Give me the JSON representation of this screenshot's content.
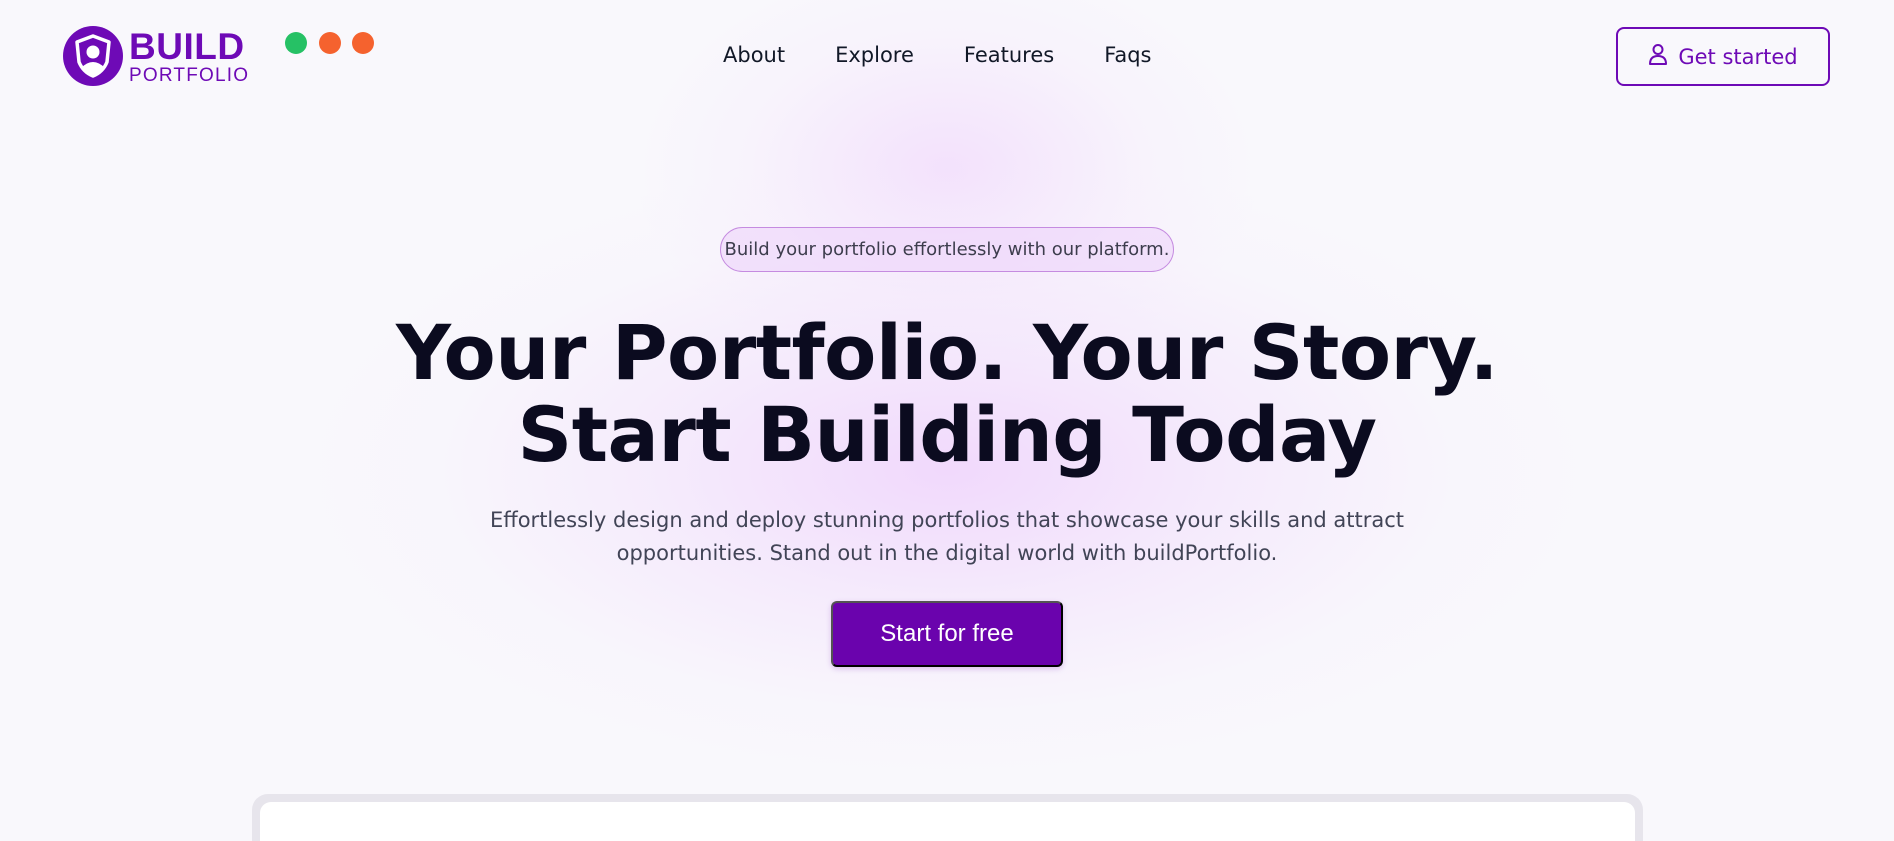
{
  "brand": {
    "name_top": "BUILD",
    "name_bottom": "PORTFOLIO",
    "accent_color": "#6e0ab6",
    "logo_icon": "shield-user-icon"
  },
  "nav": {
    "items": [
      {
        "label": "About"
      },
      {
        "label": "Explore"
      },
      {
        "label": "Features"
      },
      {
        "label": "Faqs"
      }
    ]
  },
  "header_cta": {
    "label": "Get started",
    "icon": "user-icon"
  },
  "hero": {
    "badge": "Build your portfolio effortlessly with our platform.",
    "headline_line1": "Your Portfolio. Your Story.",
    "headline_line2": "Start Building Today",
    "subtext_line1": "Effortlessly design and deploy stunning portfolios that showcase your skills and attract",
    "subtext_line2": "opportunities. Stand out in the digital world with buildPortfolio.",
    "cta_label": "Start for free",
    "cta_color": "#6a03ad"
  },
  "preview": {
    "window_dots": [
      {
        "color": "#26c165"
      },
      {
        "color": "#f5622e"
      },
      {
        "color": "#f5622e"
      }
    ]
  }
}
